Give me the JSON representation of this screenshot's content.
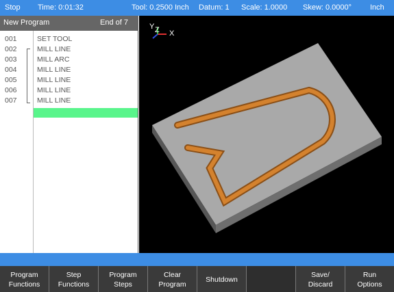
{
  "status_bar": {
    "run_state": "Stop",
    "time": "Time: 0:01:32",
    "tool": "Tool: 0.2500 Inch",
    "datum": "Datum: 1",
    "scale": "Scale: 1.0000",
    "skew": "Skew: 0.0000°",
    "units": "Inch"
  },
  "program": {
    "name": "New Program",
    "position": "End of 7",
    "steps": [
      {
        "number": "001",
        "name": "SET TOOL"
      },
      {
        "number": "002",
        "name": "MILL LINE"
      },
      {
        "number": "003",
        "name": "MILL ARC"
      },
      {
        "number": "004",
        "name": "MILL LINE"
      },
      {
        "number": "005",
        "name": "MILL LINE"
      },
      {
        "number": "006",
        "name": "MILL LINE"
      },
      {
        "number": "007",
        "name": "MILL LINE"
      }
    ]
  },
  "viewport": {
    "axis_labels": {
      "y": "Y",
      "z": "Z",
      "x": "X"
    },
    "colors": {
      "plate": "#a8a8a8",
      "groove": "#c9772a",
      "background": "#000000"
    }
  },
  "softkeys": [
    {
      "label": "Program\nFunctions"
    },
    {
      "label": "Step\nFunctions"
    },
    {
      "label": "Program\nSteps"
    },
    {
      "label": "Clear\nProgram"
    },
    {
      "label": "Shutdown"
    },
    {
      "label": ""
    },
    {
      "label": "Save/\nDiscard"
    },
    {
      "label": "Run\nOptions"
    }
  ],
  "colors": {
    "accent": "#3d8de4",
    "highlight": "#59f58b"
  }
}
